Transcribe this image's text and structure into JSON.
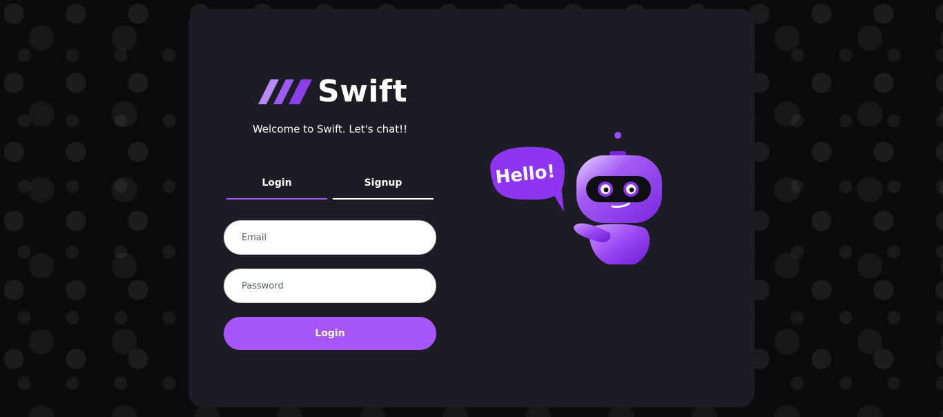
{
  "brand": {
    "name": "Swift",
    "tagline": "Welcome to Swift. Let's chat!!",
    "accent": "#a855f7"
  },
  "tabs": [
    {
      "label": "Login",
      "active": true
    },
    {
      "label": "Signup",
      "active": false
    }
  ],
  "form": {
    "email_placeholder": "Email",
    "email_value": "",
    "password_placeholder": "Password",
    "password_value": "",
    "submit_label": "Login"
  },
  "illustration": {
    "speech_bubble_text": "Hello!",
    "icon": "robot-icon"
  }
}
